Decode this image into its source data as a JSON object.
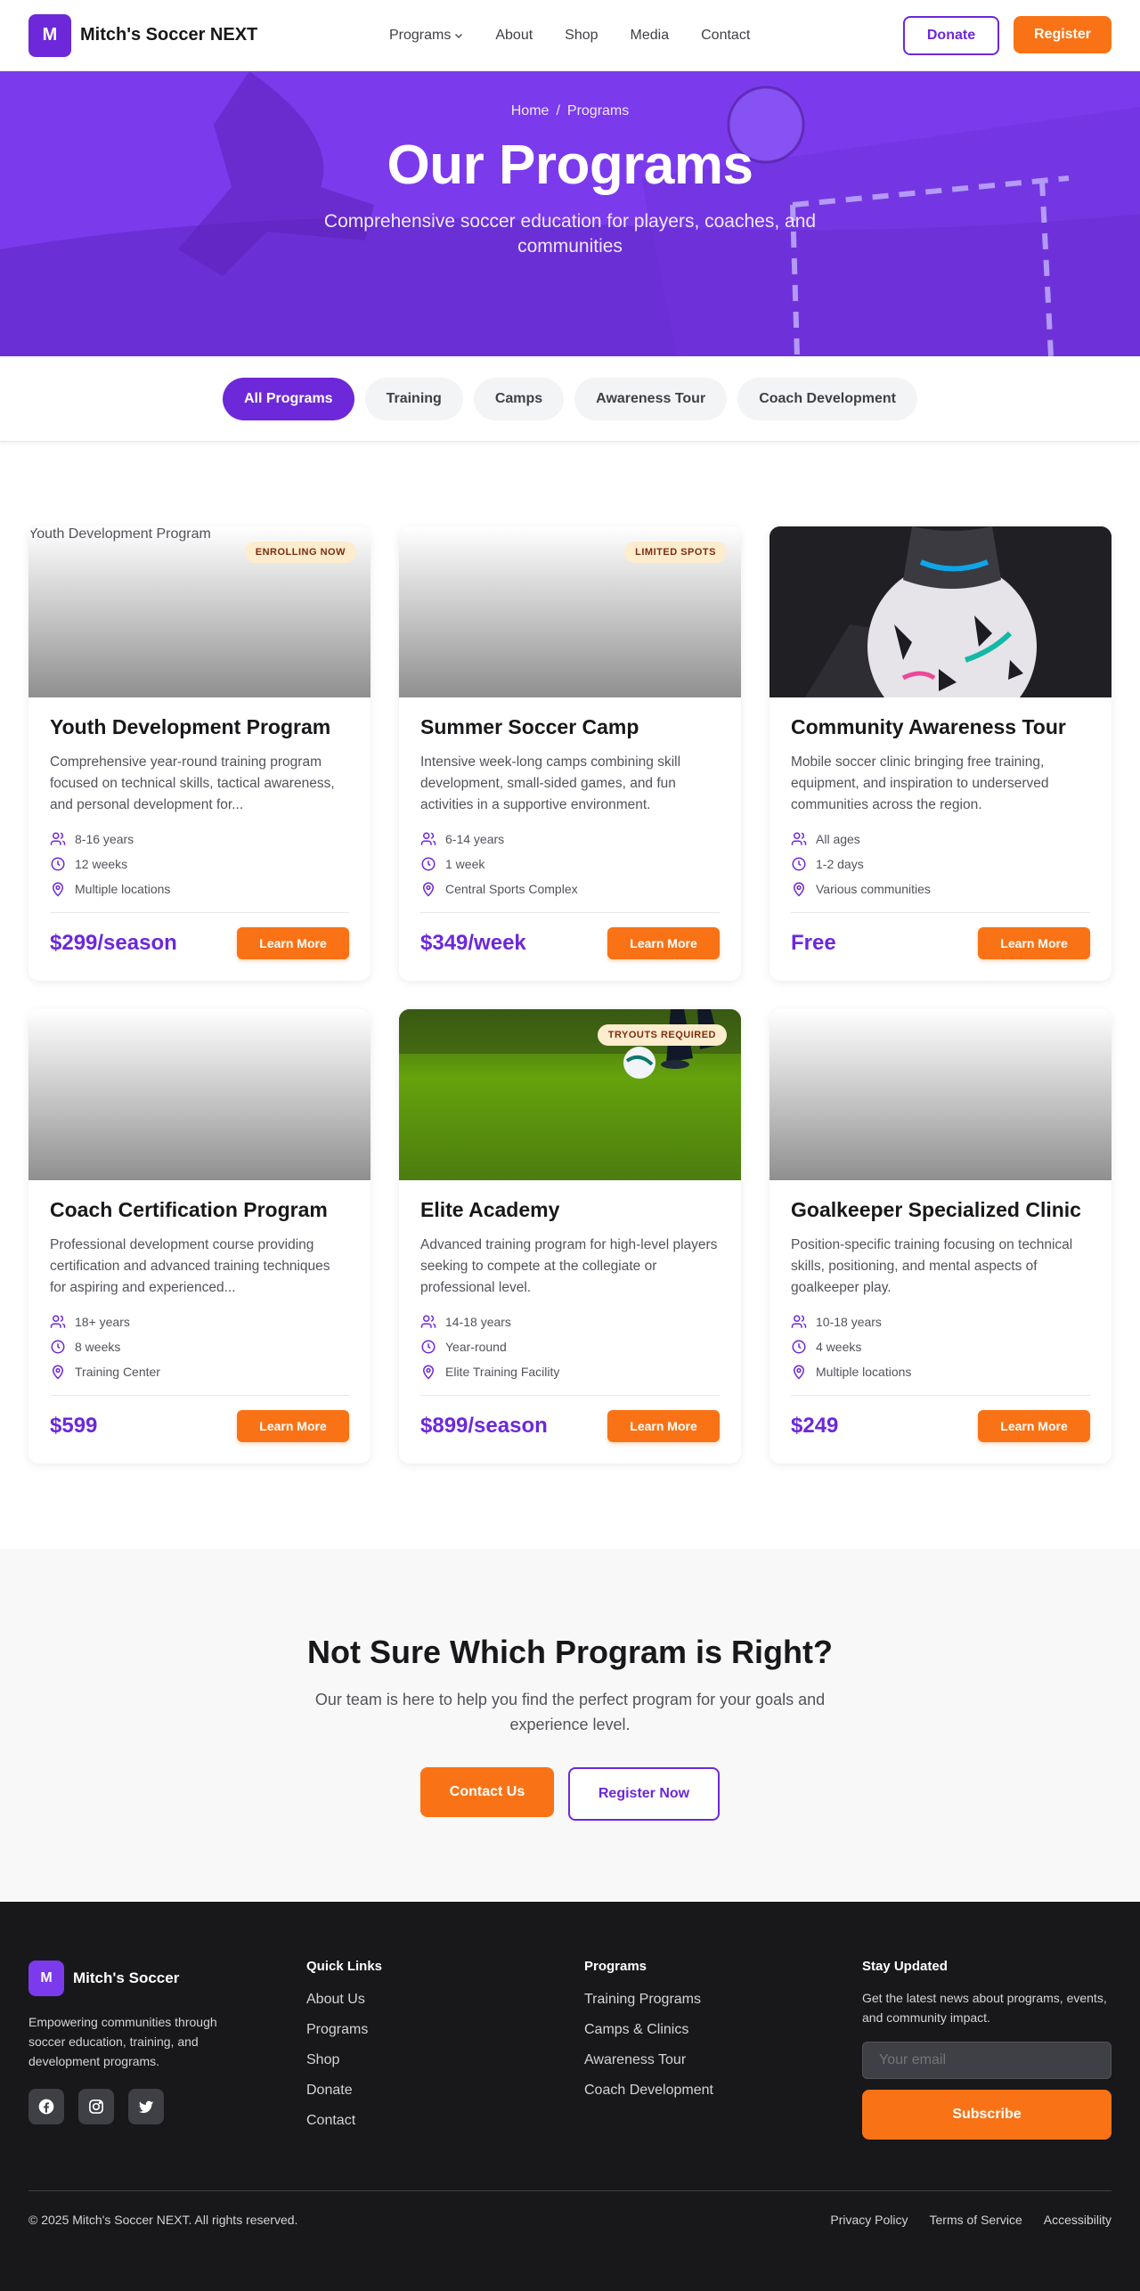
{
  "nav": {
    "logo_letter": "M",
    "brand": "Mitch's Soccer NEXT",
    "links": [
      "Programs",
      "About",
      "Shop",
      "Media",
      "Contact"
    ],
    "donate": "Donate",
    "register": "Register"
  },
  "hero": {
    "breadcrumb_home": "Home",
    "breadcrumb_sep": "/",
    "breadcrumb_current": "Programs",
    "title": "Our Programs",
    "subtitle": "Comprehensive soccer education for players, coaches, and communities"
  },
  "filters": [
    "All Programs",
    "Training",
    "Camps",
    "Awareness Tour",
    "Coach Development"
  ],
  "programs": [
    {
      "title": "Youth Development Program",
      "image_alt": "Youth Development Program",
      "badge": "ENROLLING NOW",
      "description": "Comprehensive year-round training program focused on technical skills, tactical awareness, and personal development for...",
      "ages": "8-16 years",
      "duration": "12 weeks",
      "location": "Multiple locations",
      "price": "$299/season",
      "cta": "Learn More"
    },
    {
      "title": "Summer Soccer Camp",
      "badge": "LIMITED SPOTS",
      "description": "Intensive week-long camps combining skill development, small-sided games, and fun activities in a supportive environment.",
      "ages": "6-14 years",
      "duration": "1 week",
      "location": "Central Sports Complex",
      "price": "$349/week",
      "cta": "Learn More"
    },
    {
      "title": "Community Awareness Tour",
      "description": "Mobile soccer clinic bringing free training, equipment, and inspiration to underserved communities across the region.",
      "ages": "All ages",
      "duration": "1-2 days",
      "location": "Various communities",
      "price": "Free",
      "cta": "Learn More"
    },
    {
      "title": "Coach Certification Program",
      "description": "Professional development course providing certification and advanced training techniques for aspiring and experienced...",
      "ages": "18+ years",
      "duration": "8 weeks",
      "location": "Training Center",
      "price": "$599",
      "cta": "Learn More"
    },
    {
      "title": "Elite Academy",
      "badge": "TRYOUTS REQUIRED",
      "description": "Advanced training program for high-level players seeking to compete at the collegiate or professional level.",
      "ages": "14-18 years",
      "duration": "Year-round",
      "location": "Elite Training Facility",
      "price": "$899/season",
      "cta": "Learn More"
    },
    {
      "title": "Goalkeeper Specialized Clinic",
      "description": "Position-specific training focusing on technical skills, positioning, and mental aspects of goalkeeper play.",
      "ages": "10-18 years",
      "duration": "4 weeks",
      "location": "Multiple locations",
      "price": "$249",
      "cta": "Learn More"
    }
  ],
  "cta": {
    "title": "Not Sure Which Program is Right?",
    "text": "Our team is here to help you find the perfect program for your goals and experience level.",
    "contact": "Contact Us",
    "register": "Register Now"
  },
  "footer": {
    "logo_letter": "M",
    "brand": "Mitch's Soccer",
    "tagline": "Empowering communities through soccer education, training, and development programs.",
    "quick_links_head": "Quick Links",
    "quick_links": [
      "About Us",
      "Programs",
      "Shop",
      "Donate",
      "Contact"
    ],
    "programs_head": "Programs",
    "programs": [
      "Training Programs",
      "Camps & Clinics",
      "Awareness Tour",
      "Coach Development"
    ],
    "news_head": "Stay Updated",
    "news_text": "Get the latest news about programs, events, and community impact.",
    "email_placeholder": "Your email",
    "subscribe": "Subscribe",
    "copyright": "© 2025 Mitch's Soccer NEXT. All rights reserved.",
    "legal": [
      "Privacy Policy",
      "Terms of Service",
      "Accessibility"
    ]
  },
  "colors": {
    "brand": "#6d28d9",
    "accent": "#f97316",
    "footer_bg": "#18181b"
  }
}
